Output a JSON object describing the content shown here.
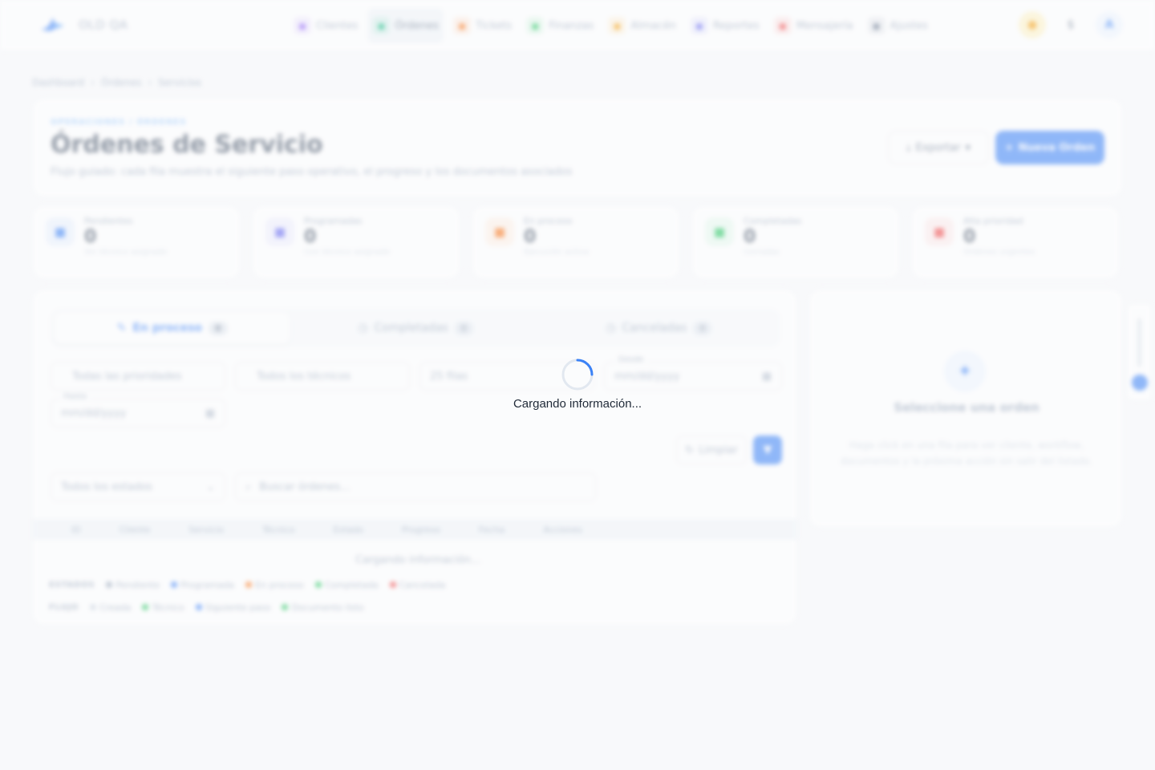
{
  "brand": {
    "name": "OLD QA"
  },
  "nav": [
    {
      "label": "Clientes",
      "icon": "users-icon",
      "color": "#8b5cf6"
    },
    {
      "label": "Órdenes",
      "icon": "clipboard-icon",
      "color": "#10b981",
      "active": true
    },
    {
      "label": "Tickets",
      "icon": "ticket-icon",
      "color": "#f97316"
    },
    {
      "label": "Finanzas",
      "icon": "dollar-icon",
      "color": "#22c55e"
    },
    {
      "label": "Almacén",
      "icon": "box-icon",
      "color": "#f59e0b"
    },
    {
      "label": "Reportes",
      "icon": "chart-icon",
      "color": "#6366f1"
    },
    {
      "label": "Mensajería",
      "icon": "message-icon",
      "color": "#ef4444"
    },
    {
      "label": "Ajustes",
      "icon": "gear-icon",
      "color": "#64748b"
    }
  ],
  "topbar": {
    "currency": "$",
    "avatar": "A"
  },
  "breadcrumb": [
    "Dashboard",
    "Órdenes",
    "Servicios"
  ],
  "header": {
    "eyebrow": "OPERACIONES / ÓRDENES",
    "title": "Órdenes de Servicio",
    "subtitle": "Flujo guiado: cada fila muestra el siguiente paso operativo, el progreso y los documentos asociados",
    "export_label": "Exportar",
    "new_label": "Nueva Orden"
  },
  "stats": [
    {
      "label": "Pendientes",
      "value": "0",
      "note": "Sin técnico asignado",
      "color": "#3b82f6"
    },
    {
      "label": "Programadas",
      "value": "0",
      "note": "Con técnico asignado",
      "color": "#6366f1"
    },
    {
      "label": "En proceso",
      "value": "0",
      "note": "Ejecución activa",
      "color": "#f97316"
    },
    {
      "label": "Completadas",
      "value": "0",
      "note": "Cerradas",
      "color": "#22c55e"
    },
    {
      "label": "Alta prioridad",
      "value": "0",
      "note": "Órdenes urgentes",
      "color": "#ef4444"
    }
  ],
  "tabs": [
    {
      "label": "En proceso",
      "count": "0",
      "active": true
    },
    {
      "label": "Completadas",
      "count": "0"
    },
    {
      "label": "Canceladas",
      "count": "0"
    }
  ],
  "filters": {
    "priority": "Todas las prioridades",
    "technician": "Todos los técnicos",
    "rows": "25 filas",
    "from_label": "Desde",
    "from_placeholder": "mm/dd/yyyy",
    "to_label": "Hasta",
    "to_placeholder": "mm/dd/yyyy",
    "clear_label": "Limpiar",
    "status": "Todos los estados",
    "search_placeholder": "Buscar órdenes..."
  },
  "table": {
    "columns": [
      "ID",
      "Cliente",
      "Servicio",
      "Técnico",
      "Estado",
      "Progreso",
      "Fecha",
      "Acciones"
    ],
    "loading": "Cargando información..."
  },
  "legend": {
    "states_title": "ESTADOS",
    "states": [
      {
        "label": "Pendiente",
        "color": "#94a3b8"
      },
      {
        "label": "Programada",
        "color": "#3b82f6"
      },
      {
        "label": "En proceso",
        "color": "#f97316"
      },
      {
        "label": "Completada",
        "color": "#22c55e"
      },
      {
        "label": "Cancelada",
        "color": "#ef4444"
      }
    ],
    "flow_title": "FLUJO",
    "flow": [
      {
        "label": "Creada",
        "color": "#cbd5e1"
      },
      {
        "label": "Técnico",
        "color": "#22c55e"
      },
      {
        "label": "Siguiente paso",
        "color": "#3b82f6"
      },
      {
        "label": "Documento listo",
        "color": "#22c55e"
      }
    ]
  },
  "detail": {
    "title": "Seleccione una orden",
    "text": "Haga click en una fila para ver cliente, workflow, documentos y la próxima acción sin salir del listado."
  },
  "overlay": {
    "loading_text": "Cargando información...",
    "accent": "#3b82f6"
  }
}
